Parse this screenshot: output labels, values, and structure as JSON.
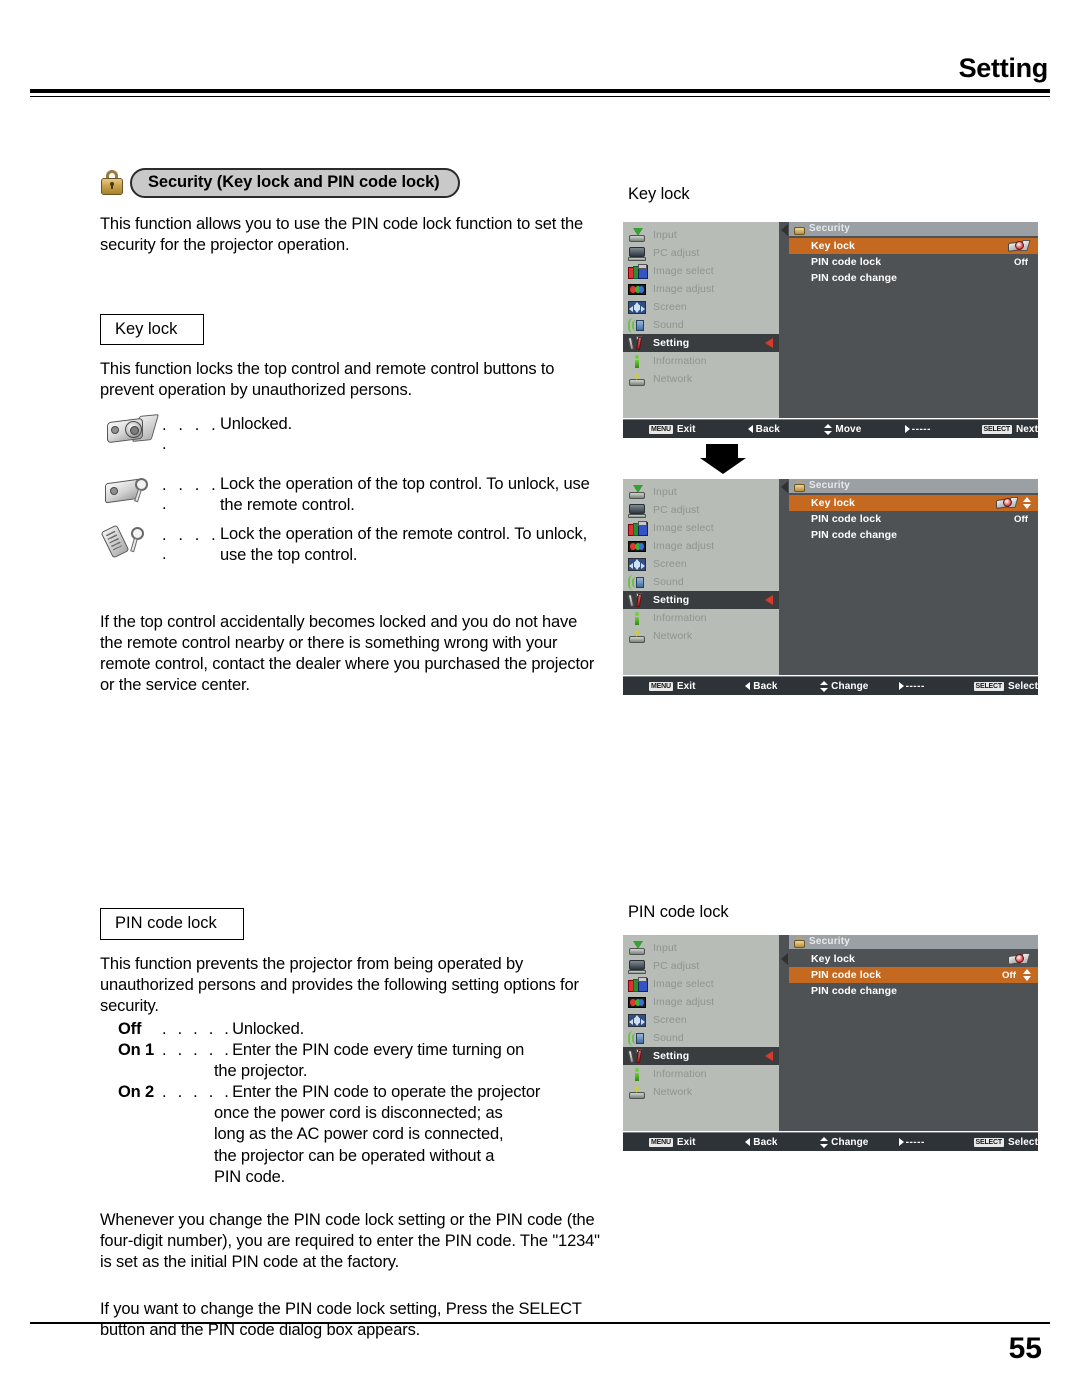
{
  "header": {
    "title": "Setting"
  },
  "footer": {
    "page_number": "55"
  },
  "section": {
    "badge_icon": "padlock-icon",
    "pill_label": "Security (Key lock and PIN code lock)",
    "intro": "This function allows you to use the PIN code lock function to set the security for the projector operation."
  },
  "key_lock": {
    "heading": "Key lock",
    "description": "This function locks the top control and remote control buttons to prevent operation by unauthorized persons.",
    "legend": [
      {
        "icon": "projector-unlocked-icon",
        "dots": ". . . . .",
        "text": "Unlocked."
      },
      {
        "icon": "projector-with-key-icon",
        "dots": ". . . . .",
        "text": "Lock the operation of the top control. To unlock, use the remote control."
      },
      {
        "icon": "remote-with-key-icon",
        "dots": ". . . . .",
        "text": "Lock the operation of the remote control. To unlock, use the top control."
      }
    ],
    "note": "If the top control accidentally becomes locked and you do not have the remote control nearby or there is something wrong with your remote control, contact the dealer where you purchased the projector or the service center."
  },
  "pin_code_lock": {
    "heading": "PIN code lock",
    "description": "This function prevents the projector from being operated by unauthorized persons and provides the following setting options for security.",
    "options": [
      {
        "label": "Off",
        "dots": ". . . . .",
        "text": "Unlocked.",
        "continuation": []
      },
      {
        "label": "On 1",
        "dots": ". . . . .",
        "text": "Enter the PIN code every time turning on",
        "continuation": [
          "the projector."
        ]
      },
      {
        "label": "On 2",
        "dots": ". . . . .",
        "text": "Enter the PIN code to operate the projector",
        "continuation": [
          "once the power cord is disconnected; as",
          "long as the AC power cord is connected,",
          "the projector can be operated without a",
          "PIN code."
        ]
      }
    ],
    "note1": "Whenever you change the PIN code lock setting or the PIN code (the four-digit number), you are required to enter the PIN code. The \"1234\" is set as the initial PIN code at the factory.",
    "note2": "If you want to change the PIN code lock setting, Press the SELECT button and the PIN code dialog box appears."
  },
  "osd_sidebar_items": [
    {
      "icon": "input-icon",
      "label": "Input"
    },
    {
      "icon": "pc-adjust-icon",
      "label": "PC adjust"
    },
    {
      "icon": "image-select-icon",
      "label": "Image select"
    },
    {
      "icon": "image-adjust-icon",
      "label": "Image adjust"
    },
    {
      "icon": "screen-icon",
      "label": "Screen"
    },
    {
      "icon": "sound-icon",
      "label": "Sound"
    },
    {
      "icon": "setting-icon",
      "label": "Setting"
    },
    {
      "icon": "information-icon",
      "label": "Information"
    },
    {
      "icon": "network-icon",
      "label": "Network"
    }
  ],
  "osd_panels": [
    {
      "caption": "Key lock",
      "menu_title": "Security",
      "rows": [
        {
          "name": "Key lock",
          "value": "",
          "value_icon": "key-lock-status-icon",
          "stepper": false,
          "selected": true
        },
        {
          "name": "PIN code lock",
          "value": "Off",
          "value_icon": "",
          "stepper": false,
          "selected": false
        },
        {
          "name": "PIN code change",
          "value": "",
          "value_icon": "",
          "stepper": false,
          "selected": false
        }
      ],
      "status": [
        {
          "chip": "MENU",
          "label": "Exit"
        },
        {
          "chip": "",
          "label": "Back",
          "glyph": "left-triangle"
        },
        {
          "chip": "",
          "label": "Move",
          "glyph": "up-down"
        },
        {
          "chip": "",
          "label": "-----",
          "glyph": "right-triangle"
        },
        {
          "chip": "SELECT",
          "label": "Next"
        }
      ]
    },
    {
      "caption": "",
      "menu_title": "Security",
      "rows": [
        {
          "name": "Key lock",
          "value": "",
          "value_icon": "key-lock-status-icon",
          "stepper": true,
          "selected": true
        },
        {
          "name": "PIN code lock",
          "value": "Off",
          "value_icon": "",
          "stepper": false,
          "selected": false
        },
        {
          "name": "PIN code change",
          "value": "",
          "value_icon": "",
          "stepper": false,
          "selected": false
        }
      ],
      "status": [
        {
          "chip": "MENU",
          "label": "Exit"
        },
        {
          "chip": "",
          "label": "Back",
          "glyph": "left-triangle"
        },
        {
          "chip": "",
          "label": "Change",
          "glyph": "up-down"
        },
        {
          "chip": "",
          "label": "-----",
          "glyph": "right-triangle"
        },
        {
          "chip": "SELECT",
          "label": "Select"
        }
      ]
    },
    {
      "caption": "PIN code lock",
      "menu_title": "Security",
      "rows": [
        {
          "name": "Key lock",
          "value": "",
          "value_icon": "key-lock-status-icon",
          "stepper": false,
          "selected": false
        },
        {
          "name": "PIN code lock",
          "value": "Off",
          "value_icon": "",
          "stepper": true,
          "selected": true
        },
        {
          "name": "PIN code change",
          "value": "",
          "value_icon": "",
          "stepper": false,
          "selected": false
        }
      ],
      "status": [
        {
          "chip": "MENU",
          "label": "Exit"
        },
        {
          "chip": "",
          "label": "Back",
          "glyph": "left-triangle"
        },
        {
          "chip": "",
          "label": "Change",
          "glyph": "up-down"
        },
        {
          "chip": "",
          "label": "-----",
          "glyph": "right-triangle"
        },
        {
          "chip": "SELECT",
          "label": "Select"
        }
      ]
    }
  ],
  "colors": {
    "highlight": "#c4691f",
    "osd_sidebar": "#b7bcb7",
    "osd_main": "#4f5255",
    "osd_status": "#2e3338",
    "red_arrow": "#d83a2e"
  }
}
